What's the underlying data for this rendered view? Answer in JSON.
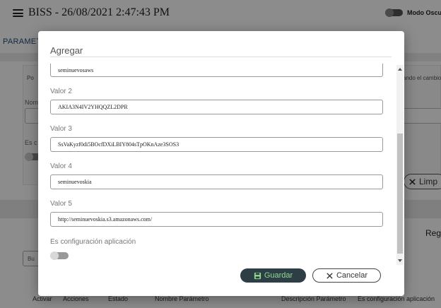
{
  "app": {
    "title": "BISS - 26/08/2021 2:47:43 PM",
    "dark_mode_label": "Modo Oscuro",
    "section_heading": "PARAMETROS",
    "hint_left": "Po",
    "hint_right": "ando el cambio",
    "name_label_partial": "Nom",
    "config_label_partial": "Es c",
    "clear_button_label": "Limp",
    "registers_label": "Reg",
    "small_button_label": "Bu",
    "table_columns": [
      "Activar",
      "Acciones",
      "Estado",
      "Nombre Parámetro",
      "Descripción Parámetro",
      "Es configuración aplicación"
    ]
  },
  "modal": {
    "title": "Agregar",
    "first_value": "seminuevosaws",
    "fields": [
      {
        "label": "Valor 2",
        "value": "AKIA3N4IV2YHQQZL2DPR"
      },
      {
        "label": "Valor 3",
        "value": "SsVaKyzf0di5BOcfDXiLBIY804sTpOKnAze3SOS3"
      },
      {
        "label": "Valor 4",
        "value": "seminuevoskia"
      },
      {
        "label": "Valor 5",
        "value": "http://seminuevoskia.s3.amazonaws.com/"
      }
    ],
    "config_label": "Es configuración aplicación",
    "config_enabled": false,
    "save_label": "Guardar",
    "cancel_label": "Cancelar"
  },
  "colors": {
    "save_bg": "#2d3e45",
    "save_text": "#8fdc8f",
    "heading": "#1f4e79"
  }
}
